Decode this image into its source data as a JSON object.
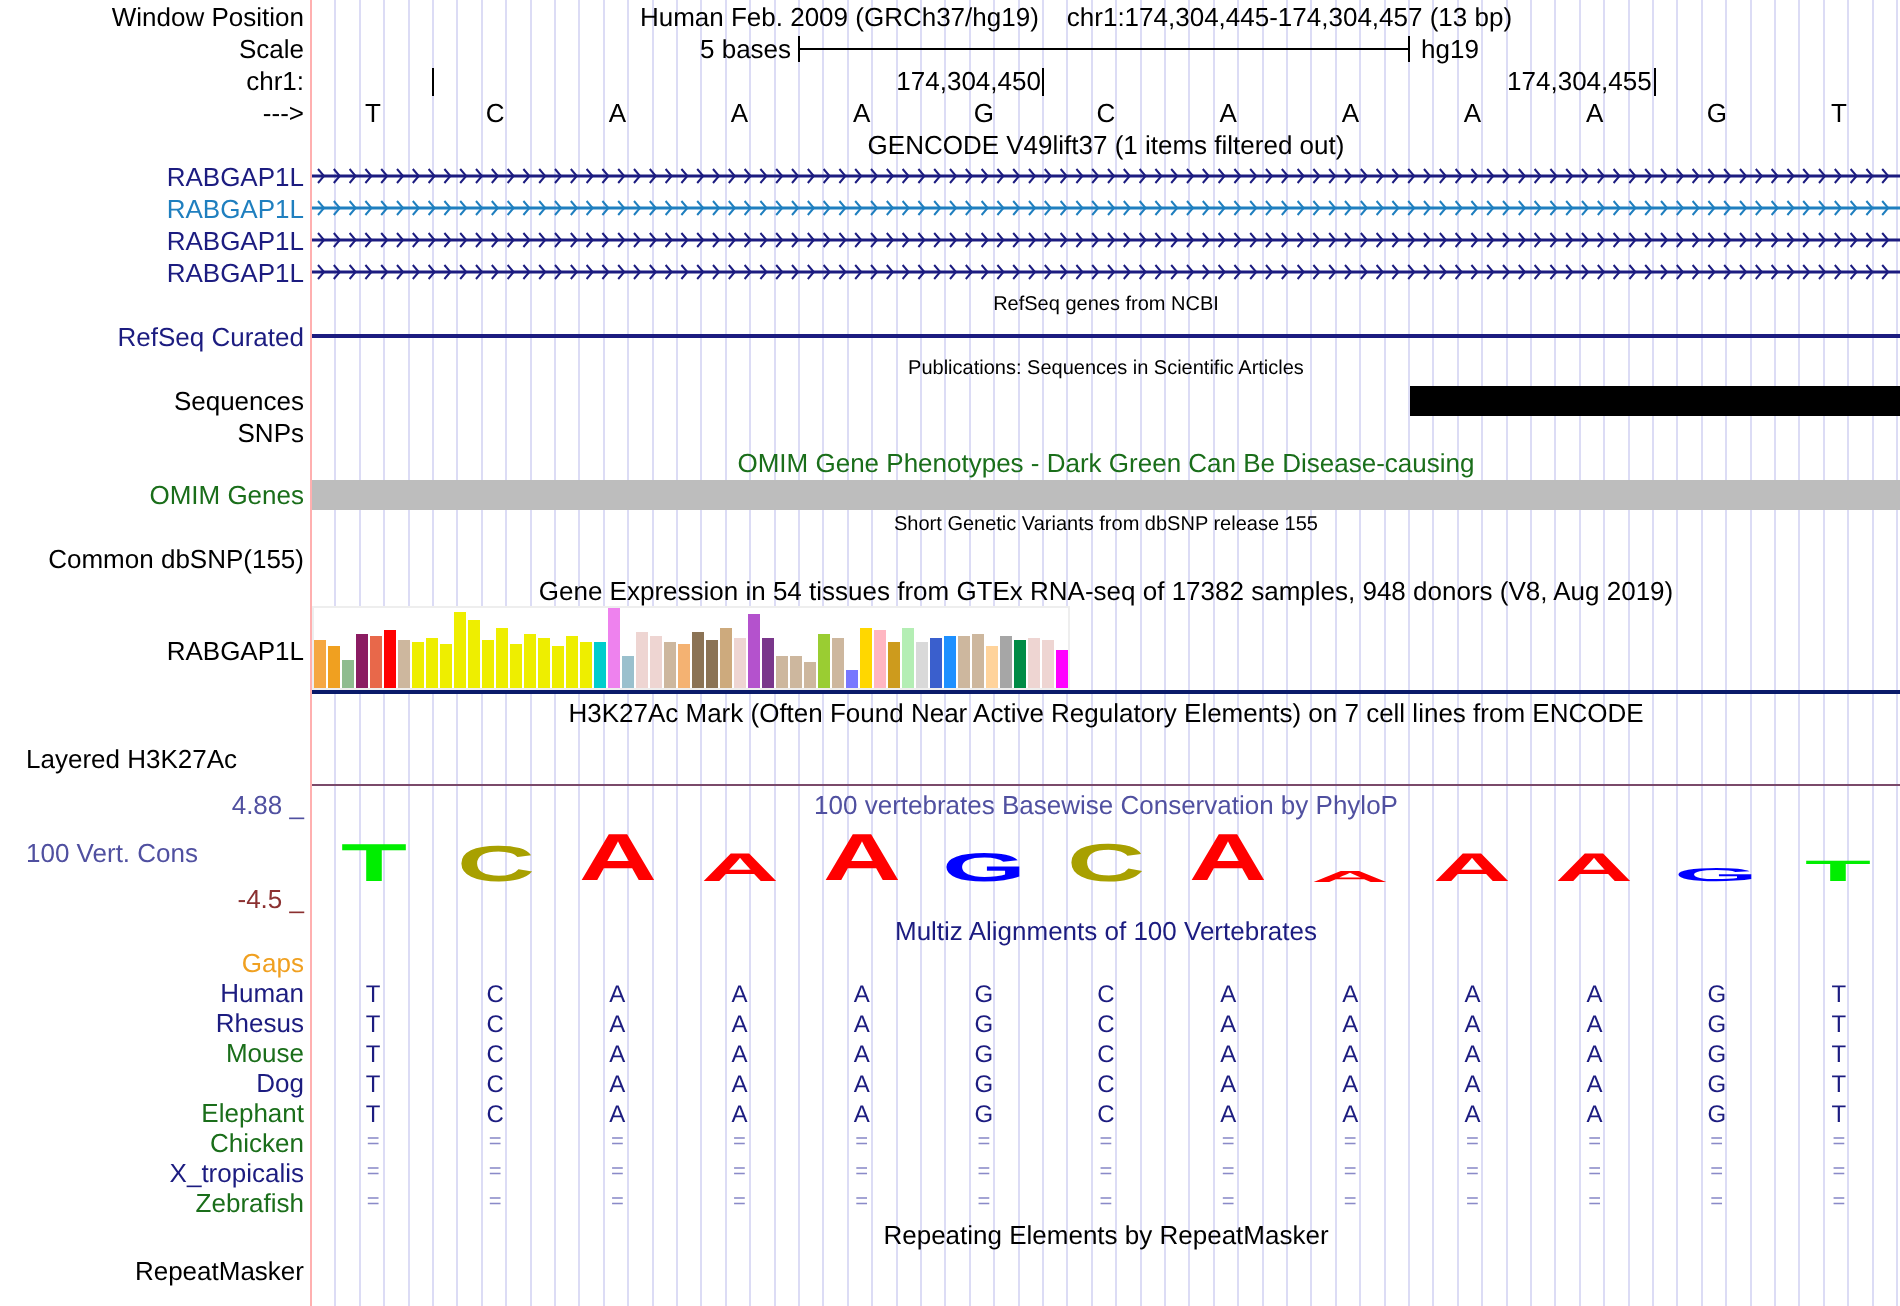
{
  "header": {
    "position_label": "Window Position",
    "assembly": "Human Feb. 2009 (GRCh37/hg19)",
    "position": "chr1:174,304,445-174,304,457 (13 bp)",
    "scale_label": "Scale",
    "scale_text": "5 bases",
    "scale_db": "hg19",
    "ruler_label": "chr1:",
    "ruler_marks": [
      "174,304,450",
      "174,304,455"
    ],
    "strand_label": "--->",
    "bases": [
      "T",
      "C",
      "A",
      "A",
      "A",
      "G",
      "C",
      "A",
      "A",
      "A",
      "A",
      "G",
      "T"
    ]
  },
  "gencode": {
    "title": "GENCODE V49lift37 (1 items filtered out)",
    "genes": [
      {
        "label": "RABGAP1L",
        "color": "#1c1c80"
      },
      {
        "label": "RABGAP1L",
        "color": "#1f7fbf"
      },
      {
        "label": "RABGAP1L",
        "color": "#1c1c80"
      },
      {
        "label": "RABGAP1L",
        "color": "#1c1c80"
      }
    ]
  },
  "refseq": {
    "title": "RefSeq genes from NCBI",
    "label": "RefSeq Curated",
    "color": "#1c1c80"
  },
  "publications": {
    "title": "Publications: Sequences in Scientific Articles",
    "label": "Sequences"
  },
  "snps": {
    "label": "SNPs"
  },
  "omim": {
    "title": "OMIM Gene Phenotypes - Dark Green Can Be Disease-causing",
    "label": "OMIM Genes",
    "color": "#1a6e1a"
  },
  "dbsnp": {
    "title": "Short Genetic Variants from dbSNP release 155",
    "label": "Common dbSNP(155)"
  },
  "gtex": {
    "title": "Gene Expression in 54 tissues from GTEx RNA-seq of 17382 samples, 948 donors (V8, Aug 2019)",
    "label": "RABGAP1L"
  },
  "h3k27ac": {
    "title": "H3K27Ac Mark (Often Found Near Active Regulatory Elements) on 7 cell lines from ENCODE",
    "label": "Layered H3K27Ac"
  },
  "conservation": {
    "title": "100 vertebrates Basewise Conservation by PhyloP",
    "label": "100 Vert. Cons",
    "max": "4.88 _",
    "min": "-4.5 _",
    "logo": [
      {
        "base": "T",
        "color": "#00ee00"
      },
      {
        "base": "C",
        "color": "#a8a000"
      },
      {
        "base": "A",
        "color": "#ff0000"
      },
      {
        "base": "A",
        "color": "#ff0000"
      },
      {
        "base": "A",
        "color": "#ff0000"
      },
      {
        "base": "G",
        "color": "#0000ff"
      },
      {
        "base": "C",
        "color": "#a8a000"
      },
      {
        "base": "A",
        "color": "#ff0000"
      },
      {
        "base": "A",
        "color": "#ff0000"
      },
      {
        "base": "A",
        "color": "#ff0000"
      },
      {
        "base": "A",
        "color": "#ff0000"
      },
      {
        "base": "G",
        "color": "#0000ff"
      },
      {
        "base": "T",
        "color": "#00ee00"
      }
    ]
  },
  "multiz": {
    "title": "Multiz Alignments of 100 Vertebrates",
    "gaps_label": "Gaps",
    "species": [
      {
        "name": "Human",
        "color": "#1c1c80",
        "kind": "bases",
        "bases": [
          "T",
          "C",
          "A",
          "A",
          "A",
          "G",
          "C",
          "A",
          "A",
          "A",
          "A",
          "G",
          "T"
        ]
      },
      {
        "name": "Rhesus",
        "color": "#1c1c80",
        "kind": "bases",
        "bases": [
          "T",
          "C",
          "A",
          "A",
          "A",
          "G",
          "C",
          "A",
          "A",
          "A",
          "A",
          "G",
          "T"
        ]
      },
      {
        "name": "Mouse",
        "color": "#1a6e1a",
        "kind": "bases",
        "bases": [
          "T",
          "C",
          "A",
          "A",
          "A",
          "G",
          "C",
          "A",
          "A",
          "A",
          "A",
          "G",
          "T"
        ]
      },
      {
        "name": "Dog",
        "color": "#1c1c80",
        "kind": "bases",
        "bases": [
          "T",
          "C",
          "A",
          "A",
          "A",
          "G",
          "C",
          "A",
          "A",
          "A",
          "A",
          "G",
          "T"
        ]
      },
      {
        "name": "Elephant",
        "color": "#1a6e1a",
        "kind": "bases",
        "bases": [
          "T",
          "C",
          "A",
          "A",
          "A",
          "G",
          "C",
          "A",
          "A",
          "A",
          "A",
          "G",
          "T"
        ]
      },
      {
        "name": "Chicken",
        "color": "#1a6e1a",
        "kind": "unaligned",
        "bases": [
          "=",
          "=",
          "=",
          "=",
          "=",
          "=",
          "=",
          "=",
          "=",
          "=",
          "=",
          "=",
          "="
        ]
      },
      {
        "name": "X_tropicalis",
        "color": "#1c1c80",
        "kind": "unaligned",
        "bases": [
          "=",
          "=",
          "=",
          "=",
          "=",
          "=",
          "=",
          "=",
          "=",
          "=",
          "=",
          "=",
          "="
        ]
      },
      {
        "name": "Zebrafish",
        "color": "#1a6e1a",
        "kind": "unaligned",
        "bases": [
          "=",
          "=",
          "=",
          "=",
          "=",
          "=",
          "=",
          "=",
          "=",
          "=",
          "=",
          "=",
          "="
        ]
      }
    ]
  },
  "repeatmasker": {
    "title": "Repeating Elements by RepeatMasker",
    "label": "RepeatMasker"
  }
}
